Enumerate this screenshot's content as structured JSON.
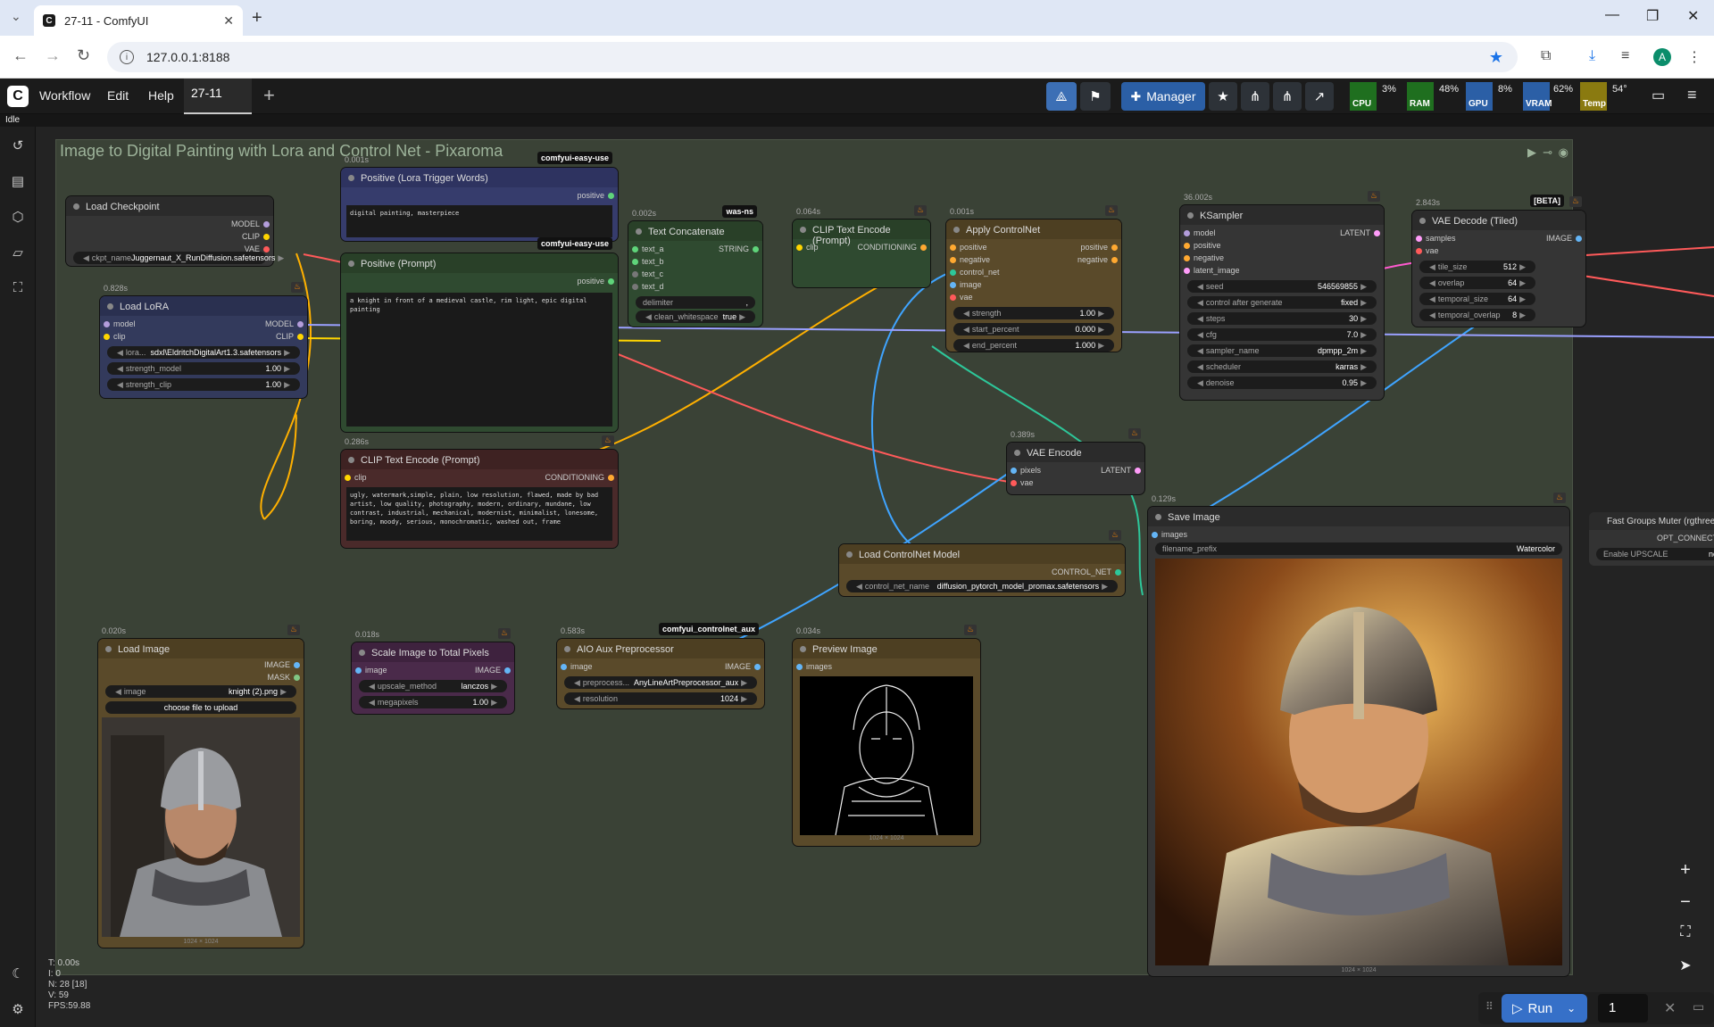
{
  "browser": {
    "tab_title": "27-11 - ComfyUI",
    "url": "127.0.0.1:8188"
  },
  "app": {
    "menu": [
      "Workflow",
      "Edit",
      "Help"
    ],
    "workflow_tab": "27-11",
    "manager_label": "Manager",
    "status": "Idle",
    "stats": {
      "cpu": {
        "label": "CPU",
        "value": "3%"
      },
      "ram": {
        "label": "RAM",
        "value": "48%"
      },
      "gpu": {
        "label": "GPU",
        "value": "8%"
      },
      "vram": {
        "label": "VRAM",
        "value": "62%"
      },
      "temp": {
        "label": "Temp",
        "value": "54°"
      }
    },
    "colors": {
      "cpu": "#1f6f1f",
      "ram": "#1f6f1f",
      "gpu": "#2b5fa6",
      "vram": "#2b5fa6",
      "temp": "#8a7a10",
      "accent": "#3670c8"
    }
  },
  "group": {
    "title": "Image to Digital Painting with Lora and Control Net - Pixaroma"
  },
  "nodes": {
    "checkpoint": {
      "title": "Load Checkpoint",
      "out_model": "MODEL",
      "out_clip": "CLIP",
      "out_vae": "VAE",
      "w_label": "ckpt_name",
      "w_value": "Juggernaut_X_RunDiffusion.safetensors"
    },
    "lora": {
      "time": "0.828s",
      "title": "Load LoRA",
      "in_model": "model",
      "in_clip": "clip",
      "out_model": "MODEL",
      "out_clip": "CLIP",
      "w1_label": "lora...",
      "w1_value": "sdxl\\EldritchDigitalArt1.3.safetensors",
      "w2_label": "strength_model",
      "w2_value": "1.00",
      "w3_label": "strength_clip",
      "w3_value": "1.00"
    },
    "pos_lora": {
      "time": "0.001s",
      "badge": "comfyui-easy-use",
      "title": "Positive (Lora Trigger Words)",
      "out": "positive",
      "text": "digital painting, masterpiece"
    },
    "pos_prompt": {
      "badge": "comfyui-easy-use",
      "title": "Positive (Prompt)",
      "out": "positive",
      "text": "a knight in front of a medieval castle, rim light, epic digital painting"
    },
    "neg": {
      "time": "0.286s",
      "title": "CLIP Text Encode (Prompt)",
      "in_clip": "clip",
      "out": "CONDITIONING",
      "text": "ugly, watermark,simple, plain, low resolution, flawed, made by bad artist, low quality, photography, modern, ordinary, mundane, low contrast, industrial, mechanical, modernist, minimalist, lonesome, boring, moody, serious, monochromatic, washed out, frame"
    },
    "concat": {
      "time": "0.002s",
      "badge": "was-ns",
      "title": "Text Concatenate",
      "in": [
        "text_a",
        "text_b",
        "text_c",
        "text_d"
      ],
      "out": "STRING",
      "w1_label": "delimiter",
      "w1_value": ",",
      "w2_label": "clean_whitespace",
      "w2_value": "true"
    },
    "clip_enc": {
      "time": "0.064s",
      "title": "CLIP Text Encode (Prompt)",
      "in_clip": "clip",
      "out": "CONDITIONING"
    },
    "apply_cn": {
      "time": "0.001s",
      "title": "Apply ControlNet",
      "in": [
        "positive",
        "negative",
        "control_net",
        "image",
        "vae"
      ],
      "out_pos": "positive",
      "out_neg": "negative",
      "w1_label": "strength",
      "w1_value": "1.00",
      "w2_label": "start_percent",
      "w2_value": "0.000",
      "w3_label": "end_percent",
      "w3_value": "1.000"
    },
    "ksampler": {
      "time": "36.002s",
      "title": "KSampler",
      "in": [
        "model",
        "positive",
        "negative",
        "latent_image"
      ],
      "out": "LATENT",
      "widgets": [
        {
          "l": "seed",
          "v": "546569855"
        },
        {
          "l": "control after generate",
          "v": "fixed"
        },
        {
          "l": "steps",
          "v": "30"
        },
        {
          "l": "cfg",
          "v": "7.0"
        },
        {
          "l": "sampler_name",
          "v": "dpmpp_2m"
        },
        {
          "l": "scheduler",
          "v": "karras"
        },
        {
          "l": "denoise",
          "v": "0.95"
        }
      ]
    },
    "vae_decode": {
      "time": "2.843s",
      "badge": "[BETA]",
      "title": "VAE Decode (Tiled)",
      "in_samples": "samples",
      "in_vae": "vae",
      "out": "IMAGE",
      "widgets": [
        {
          "l": "tile_size",
          "v": "512"
        },
        {
          "l": "overlap",
          "v": "64"
        },
        {
          "l": "temporal_size",
          "v": "64"
        },
        {
          "l": "temporal_overlap",
          "v": "8"
        }
      ]
    },
    "vae_encode": {
      "time": "0.389s",
      "title": "VAE Encode",
      "in_pixels": "pixels",
      "in_vae": "vae",
      "out": "LATENT"
    },
    "cn_loader": {
      "title": "Load ControlNet Model",
      "out": "CONTROL_NET",
      "w_label": "control_net_name",
      "w_value": "diffusion_pytorch_model_promax.safetensors"
    },
    "save": {
      "time": "0.129s",
      "title": "Save Image",
      "in": "images",
      "w_label": "filename_prefix",
      "w_value": "Watercolor",
      "dims": "1024 × 1024"
    },
    "load_img": {
      "time": "0.020s",
      "title": "Load Image",
      "out_image": "IMAGE",
      "out_mask": "MASK",
      "w_label": "image",
      "w_value": "knight (2).png",
      "upload": "choose file to upload",
      "dims": "1024 × 1024"
    },
    "scale": {
      "time": "0.018s",
      "title": "Scale Image to Total Pixels",
      "in": "image",
      "out": "IMAGE",
      "w1_label": "upscale_method",
      "w1_value": "lanczos",
      "w2_label": "megapixels",
      "w2_value": "1.00"
    },
    "aio": {
      "time": "0.583s",
      "badge": "comfyui_controlnet_aux",
      "title": "AIO Aux Preprocessor",
      "in": "image",
      "out": "IMAGE",
      "w1_label": "preprocess...",
      "w1_value": "AnyLineArtPreprocessor_aux",
      "w2_label": "resolution",
      "w2_value": "1024"
    },
    "preview": {
      "time": "0.034s",
      "title": "Preview Image",
      "in": "images",
      "dims": "1024 × 1024"
    },
    "muter": {
      "title": "Fast Groups Muter (rgthree)",
      "out": "OPT_CONNECTION",
      "w_label": "Enable UPSCALE",
      "w_value": "no"
    }
  },
  "canvas_stats": {
    "t": "T: 0.00s",
    "i": "I: 0",
    "n": "N: 28 [18]",
    "v": "V: 59",
    "fps": "FPS:59.88"
  },
  "run": {
    "label": "Run",
    "count": "1"
  }
}
